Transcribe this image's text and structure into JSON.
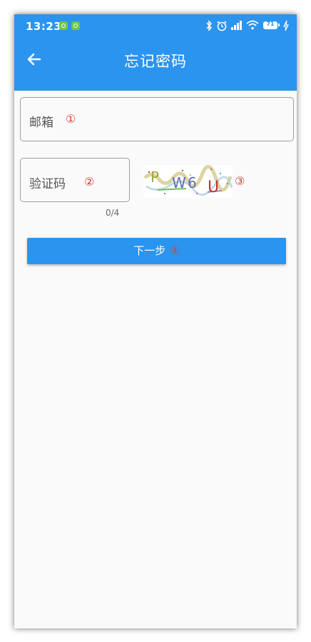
{
  "status_bar": {
    "time": "13:23",
    "battery": "71"
  },
  "app_bar": {
    "title": "忘记密码",
    "back_icon": "arrow-left-icon"
  },
  "form": {
    "email": {
      "label": "邮箱",
      "marker": "①"
    },
    "captcha_input": {
      "label": "验证码",
      "marker": "②",
      "counter": "0/4"
    },
    "captcha_image": {
      "text": "PW6U",
      "marker": "③"
    },
    "next_button": {
      "label": "下一步",
      "marker": "④"
    }
  },
  "colors": {
    "primary": "#2b94ef",
    "marker": "#e53935",
    "background": "#fafafa"
  }
}
